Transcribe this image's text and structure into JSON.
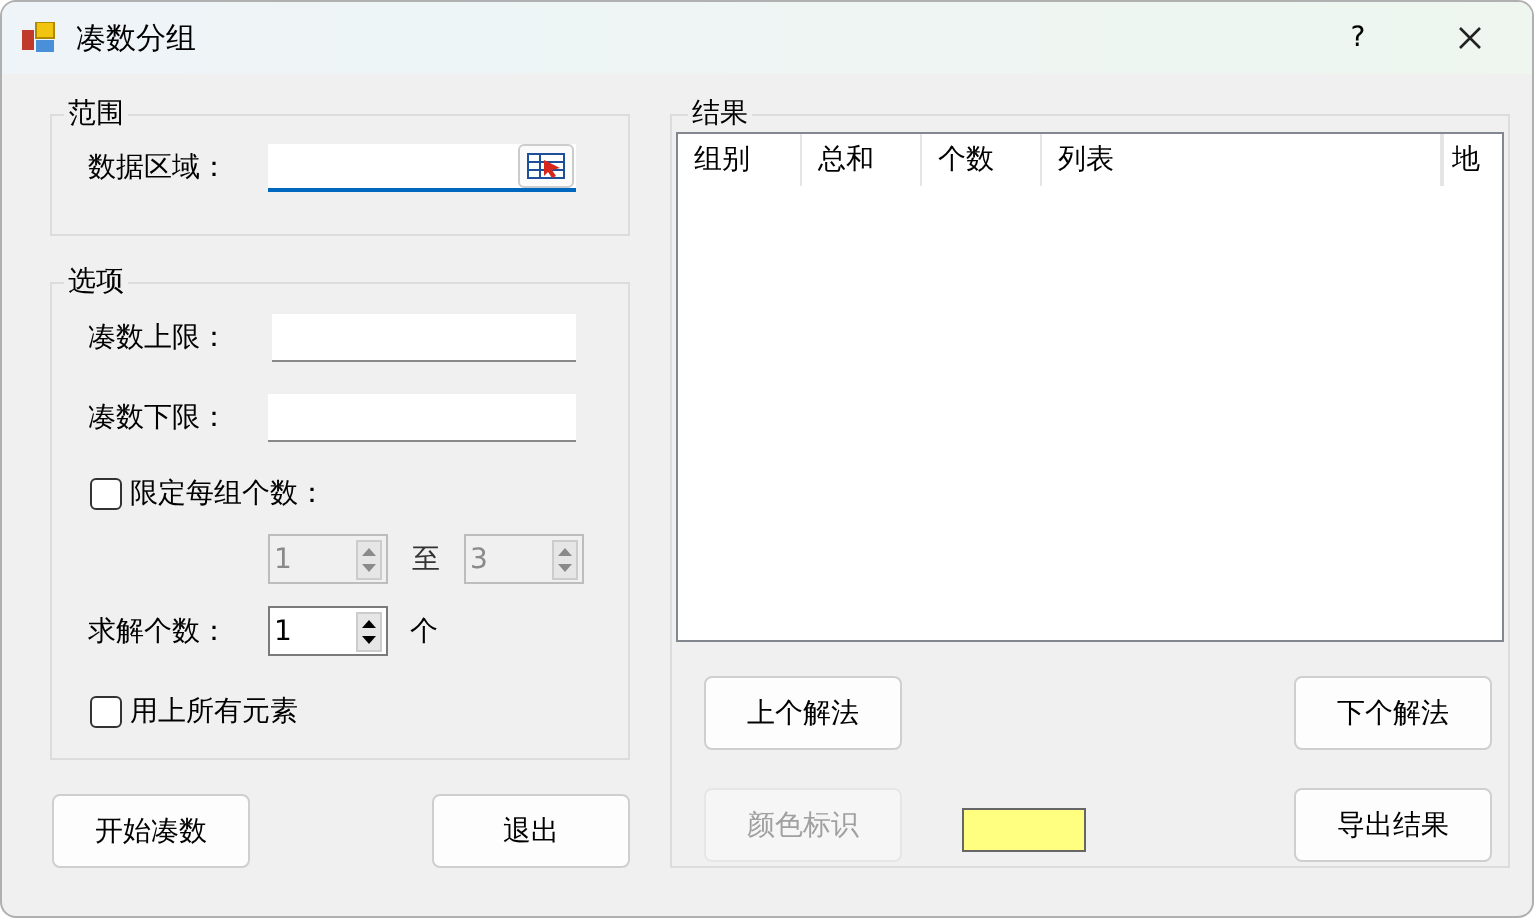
{
  "window": {
    "title": "凑数分组",
    "help": "?"
  },
  "range": {
    "title": "范围",
    "label": "数据区域：",
    "focused": true
  },
  "options": {
    "title": "选项",
    "upper_label": "凑数上限：",
    "lower_label": "凑数下限：",
    "limit_checkbox": {
      "label": "限定每组个数：",
      "checked": false
    },
    "count_min": {
      "value": "1",
      "disabled": true
    },
    "range_separator": "至",
    "count_max": {
      "value": "3",
      "disabled": true
    },
    "solutions_label": "求解个数：",
    "solutions": {
      "value": "1",
      "disabled": false
    },
    "solutions_unit": "个",
    "use_all_checkbox": {
      "label": "用上所有元素",
      "checked": false
    }
  },
  "left_buttons": [
    {
      "label": "开始凑数",
      "disabled": false
    },
    {
      "label": "退出",
      "disabled": false
    }
  ],
  "results": {
    "title": "结果",
    "columns": [
      "组别",
      "总和",
      "个数",
      "列表",
      "地"
    ],
    "prev_button": {
      "label": "上个解法",
      "disabled": false
    },
    "next_button": {
      "label": "下个解法",
      "disabled": false
    },
    "color_button": {
      "label": "颜色标识",
      "disabled": true
    },
    "color_swatch": {
      "color": "#ffff80"
    },
    "export_button": {
      "label": "导出结果",
      "disabled": false
    }
  }
}
